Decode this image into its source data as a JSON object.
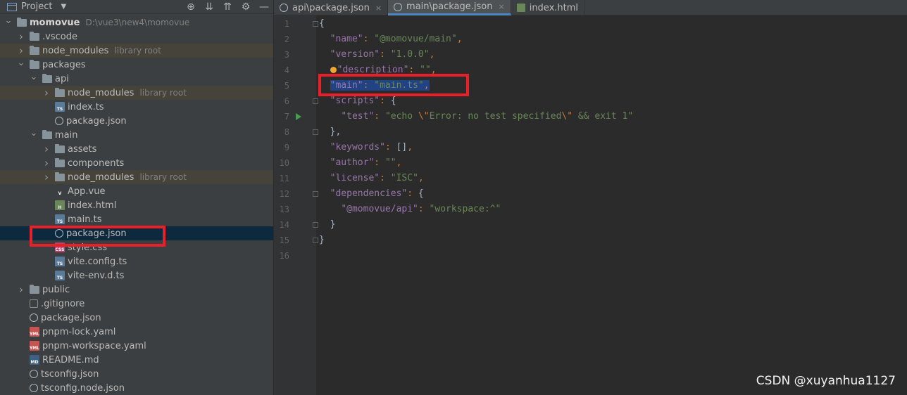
{
  "project_panel": {
    "title": "Project",
    "tools": [
      "target-icon",
      "expand-all-icon",
      "collapse-all-icon",
      "gear-icon",
      "minimize-icon"
    ],
    "tree": [
      {
        "name": "momovue",
        "hint": "D:\\vue3\\new4\\momovue",
        "type": "folder",
        "depth": 0,
        "expanded": true,
        "bold": true
      },
      {
        "name": ".vscode",
        "type": "folder",
        "depth": 1,
        "expanded": false
      },
      {
        "name": "node_modules",
        "hint": "library root",
        "type": "folder",
        "depth": 1,
        "expanded": false,
        "lib": true
      },
      {
        "name": "packages",
        "type": "folder",
        "depth": 1,
        "expanded": true
      },
      {
        "name": "api",
        "type": "folder",
        "depth": 2,
        "expanded": true
      },
      {
        "name": "node_modules",
        "hint": "library root",
        "type": "folder",
        "depth": 3,
        "expanded": false,
        "lib": true
      },
      {
        "name": "index.ts",
        "type": "ts",
        "depth": 3
      },
      {
        "name": "package.json",
        "type": "json",
        "depth": 3
      },
      {
        "name": "main",
        "type": "folder",
        "depth": 2,
        "expanded": true
      },
      {
        "name": "assets",
        "type": "folder",
        "depth": 3,
        "expanded": false
      },
      {
        "name": "components",
        "type": "folder",
        "depth": 3,
        "expanded": false
      },
      {
        "name": "node_modules",
        "hint": "library root",
        "type": "folder",
        "depth": 3,
        "expanded": false,
        "lib": true
      },
      {
        "name": "App.vue",
        "type": "vue",
        "depth": 3
      },
      {
        "name": "index.html",
        "type": "html",
        "depth": 3
      },
      {
        "name": "main.ts",
        "type": "ts",
        "depth": 3
      },
      {
        "name": "package.json",
        "type": "json",
        "depth": 3,
        "selected": true
      },
      {
        "name": "style.css",
        "type": "css",
        "depth": 3
      },
      {
        "name": "vite.config.ts",
        "type": "ts",
        "depth": 3
      },
      {
        "name": "vite-env.d.ts",
        "type": "ts",
        "depth": 3
      },
      {
        "name": "public",
        "type": "folder",
        "depth": 1,
        "expanded": false
      },
      {
        "name": ".gitignore",
        "type": "git",
        "depth": 1
      },
      {
        "name": "package.json",
        "type": "json",
        "depth": 1
      },
      {
        "name": "pnpm-lock.yaml",
        "type": "yaml",
        "depth": 1
      },
      {
        "name": "pnpm-workspace.yaml",
        "type": "yaml",
        "depth": 1
      },
      {
        "name": "README.md",
        "type": "md",
        "depth": 1
      },
      {
        "name": "tsconfig.json",
        "type": "json",
        "depth": 1
      },
      {
        "name": "tsconfig.node.json",
        "type": "json",
        "depth": 1
      }
    ]
  },
  "editor": {
    "tabs": [
      {
        "label": "api\\package.json",
        "icon": "json",
        "active": false,
        "close": "×"
      },
      {
        "label": "main\\package.json",
        "icon": "json",
        "active": true,
        "close": "×"
      },
      {
        "label": "index.html",
        "icon": "html",
        "active": false,
        "close": ""
      }
    ],
    "lines": [
      {
        "n": "1",
        "tokens": [
          [
            "b",
            "{"
          ]
        ]
      },
      {
        "n": "2",
        "tokens": [
          [
            "b",
            "  "
          ],
          [
            "k",
            "\"name\""
          ],
          [
            "p",
            ": "
          ],
          [
            "s",
            "\"@momovue/main\""
          ],
          [
            "p",
            ","
          ]
        ]
      },
      {
        "n": "3",
        "tokens": [
          [
            "b",
            "  "
          ],
          [
            "k",
            "\"version\""
          ],
          [
            "p",
            ": "
          ],
          [
            "s",
            "\"1.0.0\""
          ],
          [
            "p",
            ","
          ]
        ]
      },
      {
        "n": "4",
        "tokens": [
          [
            "bulb",
            ""
          ],
          [
            "k",
            "\"description\""
          ],
          [
            "p",
            ": "
          ],
          [
            "s",
            "\"\""
          ],
          [
            "p",
            ","
          ]
        ]
      },
      {
        "n": "5",
        "tokens": [
          [
            "b",
            "  "
          ],
          [
            "sel-k",
            "\"main\""
          ],
          [
            "sel-p",
            ": "
          ],
          [
            "sel-s",
            "\"main.ts\""
          ],
          [
            "sel-p",
            ","
          ]
        ]
      },
      {
        "n": "6",
        "tokens": [
          [
            "b",
            "  "
          ],
          [
            "k",
            "\"scripts\""
          ],
          [
            "p",
            ": "
          ],
          [
            "b",
            "{"
          ]
        ]
      },
      {
        "n": "7",
        "tokens": [
          [
            "b",
            "    "
          ],
          [
            "k",
            "\"test\""
          ],
          [
            "p",
            ": "
          ],
          [
            "s",
            "\"echo "
          ],
          [
            "p",
            "\\\""
          ],
          [
            "s",
            "Error: no test specified"
          ],
          [
            "p",
            "\\\""
          ],
          [
            "s",
            " && exit 1\""
          ]
        ]
      },
      {
        "n": "8",
        "tokens": [
          [
            "b",
            "  },"
          ]
        ]
      },
      {
        "n": "9",
        "tokens": [
          [
            "b",
            "  "
          ],
          [
            "k",
            "\"keywords\""
          ],
          [
            "p",
            ": "
          ],
          [
            "b",
            "[]"
          ],
          [
            "p",
            ","
          ]
        ]
      },
      {
        "n": "10",
        "tokens": [
          [
            "b",
            "  "
          ],
          [
            "k",
            "\"author\""
          ],
          [
            "p",
            ": "
          ],
          [
            "s",
            "\"\""
          ],
          [
            "p",
            ","
          ]
        ]
      },
      {
        "n": "11",
        "tokens": [
          [
            "b",
            "  "
          ],
          [
            "k",
            "\"license\""
          ],
          [
            "p",
            ": "
          ],
          [
            "s",
            "\"ISC\""
          ],
          [
            "p",
            ","
          ]
        ]
      },
      {
        "n": "12",
        "tokens": [
          [
            "b",
            "  "
          ],
          [
            "k",
            "\"dependencies\""
          ],
          [
            "p",
            ": "
          ],
          [
            "b",
            "{"
          ]
        ]
      },
      {
        "n": "13",
        "tokens": [
          [
            "b",
            "    "
          ],
          [
            "k",
            "\"@momovue/api\""
          ],
          [
            "p",
            ": "
          ],
          [
            "s",
            "\"workspace:^\""
          ]
        ]
      },
      {
        "n": "14",
        "tokens": [
          [
            "b",
            "  }"
          ]
        ]
      },
      {
        "n": "15",
        "tokens": [
          [
            "b",
            "}"
          ]
        ]
      },
      {
        "n": "16",
        "tokens": []
      }
    ]
  },
  "watermark": "CSDN @xuyanhua1127",
  "colors": {
    "highlight_box": "#e8202a",
    "selection": "#214283",
    "accent": "#4a88c7"
  }
}
